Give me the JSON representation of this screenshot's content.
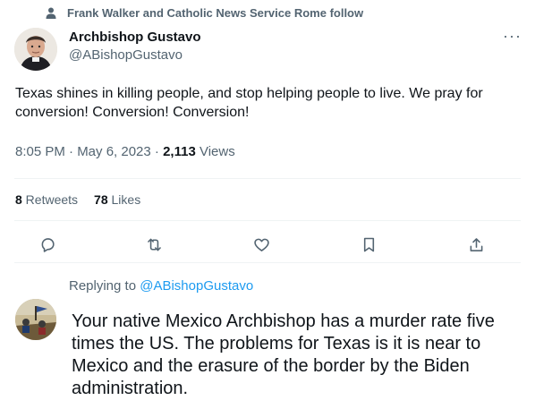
{
  "social_context": {
    "text": "Frank Walker and Catholic News Service Rome follow",
    "icon": "person-icon"
  },
  "tweet": {
    "author_name": "Archbishop Gustavo",
    "author_handle": "@ABishopGustavo",
    "text": "Texas shines in killing people, and stop helping people to live. We pray for conversion! Conversion! Conversion!",
    "time": "8:05 PM · May 6, 2023 · ",
    "views_count": "2,113",
    "views_label": " Views",
    "retweets_count": "8",
    "retweets_label": " Retweets",
    "likes_count": "78",
    "likes_label": " Likes",
    "more_label": "···"
  },
  "actions": [
    {
      "name": "reply-icon"
    },
    {
      "name": "retweet-icon"
    },
    {
      "name": "like-icon"
    },
    {
      "name": "bookmark-icon"
    },
    {
      "name": "share-icon"
    }
  ],
  "reply": {
    "replying_prefix": "Replying to ",
    "replying_handle": "@ABishopGustavo",
    "text": "Your native Mexico Archbishop has a murder rate five times the US.  The problems for Texas is it is near to Mexico and the erasure of the border by the Biden administration."
  },
  "colors": {
    "accent": "#1d9bf0",
    "muted": "#536471",
    "text": "#0f1419",
    "divider": "#eff3f4"
  }
}
